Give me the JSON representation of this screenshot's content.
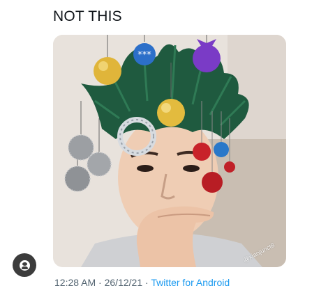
{
  "tweet": {
    "text": "NOT THIS",
    "time": "12:28 AM",
    "date": "26/12/21",
    "source": "Twitter for Android",
    "separator": "·"
  },
  "media": {
    "watermark": "@xiaojunct8"
  },
  "icons": {
    "account_button": "user-circle-icon"
  }
}
